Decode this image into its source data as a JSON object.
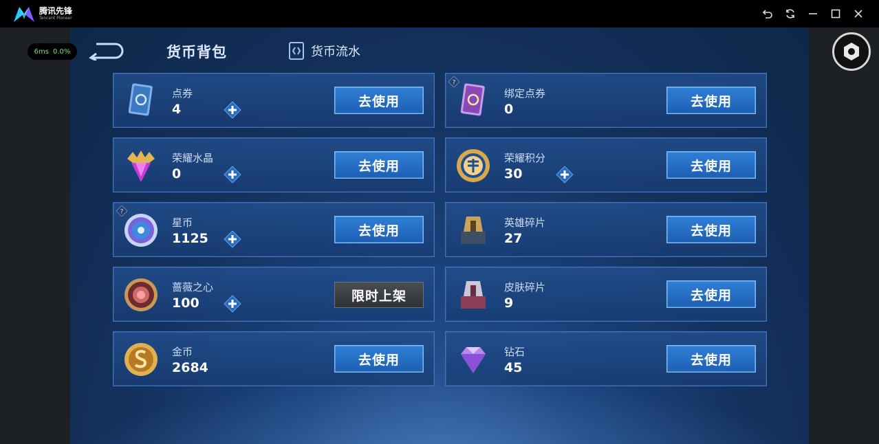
{
  "window": {
    "app_name": "腾讯先锋",
    "app_subtitle": "Tencent Pioneer"
  },
  "perf": {
    "latency": "6ms",
    "loss": "0.0%"
  },
  "header": {
    "title": "货币背包",
    "flow_tab": "货币流水"
  },
  "currencies": [
    {
      "name": "点券",
      "amount": "4",
      "action": "去使用",
      "has_plus": true,
      "icon": "voucher-card-icon"
    },
    {
      "name": "绑定点券",
      "amount": "0",
      "action": "去使用",
      "has_plus": false,
      "icon": "bound-voucher-card-icon"
    },
    {
      "name": "荣耀水晶",
      "amount": "0",
      "action": "去使用",
      "has_plus": true,
      "icon": "glory-crystal-icon"
    },
    {
      "name": "荣耀积分",
      "amount": "30",
      "action": "去使用",
      "has_plus": true,
      "icon": "glory-points-icon"
    },
    {
      "name": "星币",
      "amount": "1125",
      "action": "去使用",
      "has_plus": true,
      "icon": "star-coin-icon"
    },
    {
      "name": "英雄碎片",
      "amount": "27",
      "action": "去使用",
      "has_plus": false,
      "icon": "hero-fragment-icon"
    },
    {
      "name": "蔷薇之心",
      "amount": "100",
      "action": "限时上架",
      "has_plus": true,
      "icon": "rose-heart-icon"
    },
    {
      "name": "皮肤碎片",
      "amount": "9",
      "action": "去使用",
      "has_plus": false,
      "icon": "skin-fragment-icon"
    },
    {
      "name": "金币",
      "amount": "2684",
      "action": "去使用",
      "has_plus": false,
      "icon": "gold-coin-icon"
    },
    {
      "name": "钻石",
      "amount": "45",
      "action": "去使用",
      "has_plus": false,
      "icon": "diamond-icon"
    }
  ],
  "colors": {
    "button_blue": "#1d5fb3",
    "button_gray": "#3a3d42",
    "card_border": "#3f78bf",
    "accent_cyan": "#4ecbff"
  }
}
